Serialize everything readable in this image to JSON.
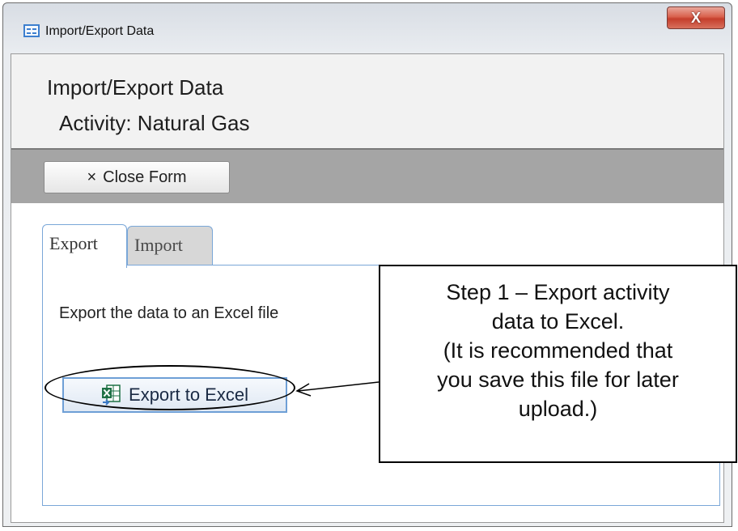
{
  "window": {
    "title": "Import/Export Data",
    "close_glyph": "X"
  },
  "form": {
    "title": "Import/Export Data",
    "subtitle": "Activity: Natural Gas"
  },
  "toolbar": {
    "close_form_icon": "×",
    "close_form_label": "Close Form"
  },
  "tabs": [
    {
      "label": "Export",
      "selected": true
    },
    {
      "label": "Import",
      "selected": false
    }
  ],
  "export_panel": {
    "description": "Export the data to an Excel file",
    "button_label": "Export to Excel",
    "button_icon": "excel-icon"
  },
  "callout": {
    "lines": [
      "Step 1 – Export activity",
      "data to Excel.",
      "(It is recommended that",
      "you save this file for later",
      "upload.)"
    ]
  },
  "colors": {
    "close_button": "#d9614d",
    "toolbar": "#a5a5a5",
    "tab_border": "#7aa7d8",
    "excel_green": "#1e7145"
  }
}
